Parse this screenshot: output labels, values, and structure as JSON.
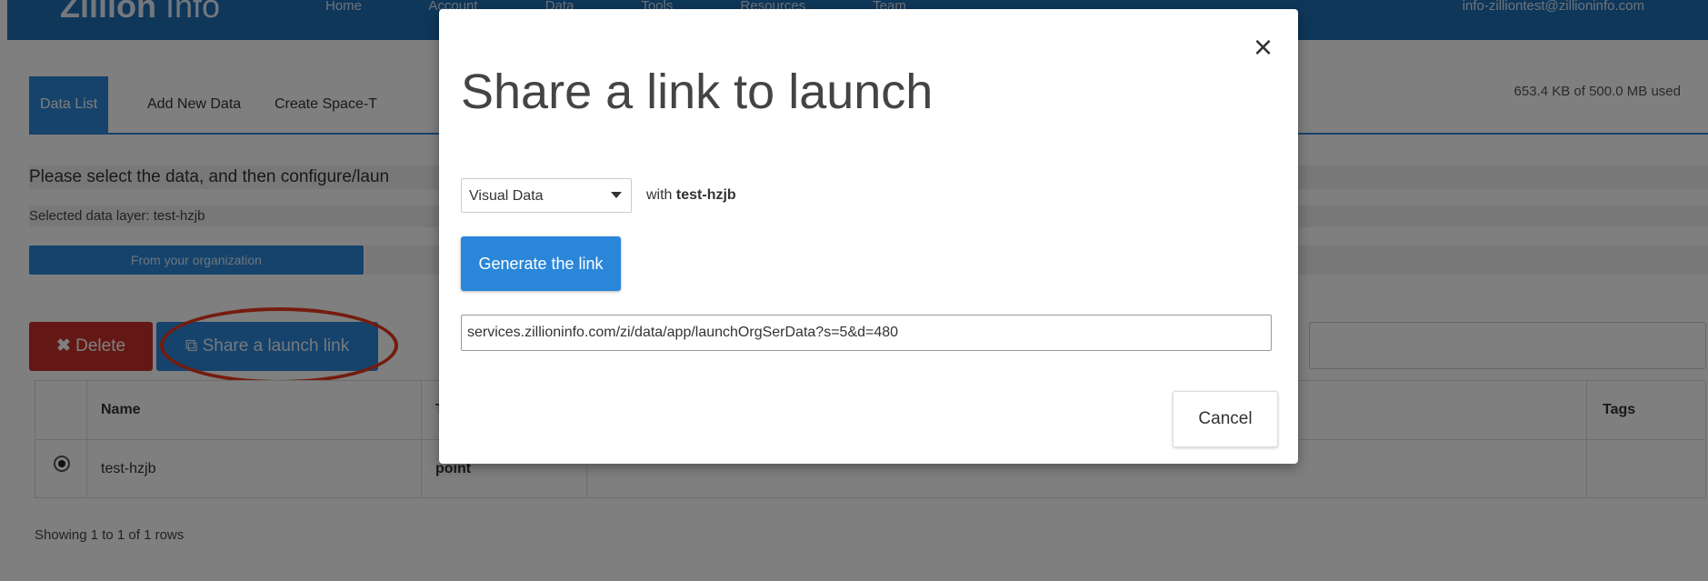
{
  "header": {
    "brand_bold": "Zillion",
    "brand_light": "Info",
    "nav": [
      "Home",
      "Account",
      "Data",
      "Tools",
      "Resources",
      "Team"
    ],
    "user_email": "info-zilliontest@zillioninfo.com"
  },
  "tabs": [
    {
      "label": "Data List",
      "active": true
    },
    {
      "label": "Add New Data",
      "active": false
    },
    {
      "label": "Create Space-T",
      "active": false
    }
  ],
  "usage": "653.4 KB of 500.0 MB used",
  "instruction": "Please select the data, and then configure/laun",
  "selected_layer": "Selected data layer: test-hzjb",
  "org_button": "From your organization",
  "actions": {
    "delete": "Delete",
    "delete_icon": "x-icon",
    "share": "Share a launch link",
    "share_icon": "share-icon"
  },
  "table": {
    "headers": {
      "name": "Name",
      "type": "T",
      "tags": "Tags"
    },
    "rows": [
      {
        "selected": true,
        "name": "test-hzjb",
        "type": "point",
        "tags": ""
      }
    ]
  },
  "footer": {
    "showing": "Showing 1 to 1 of 1 rows"
  },
  "modal": {
    "title": "Share a link to launch",
    "close": "×",
    "select_value": "Visual Data",
    "with_label": "with",
    "with_value": "test-hzjb",
    "generate_button": "Generate the link",
    "link_value": "services.zillioninfo.com/zi/data/app/launchOrgSerData?s=5&d=480",
    "cancel_button": "Cancel"
  },
  "colors": {
    "primary": "#2a86d8",
    "danger": "#c9302c",
    "highlight": "#e8391f",
    "header": "#1f6fb5"
  }
}
